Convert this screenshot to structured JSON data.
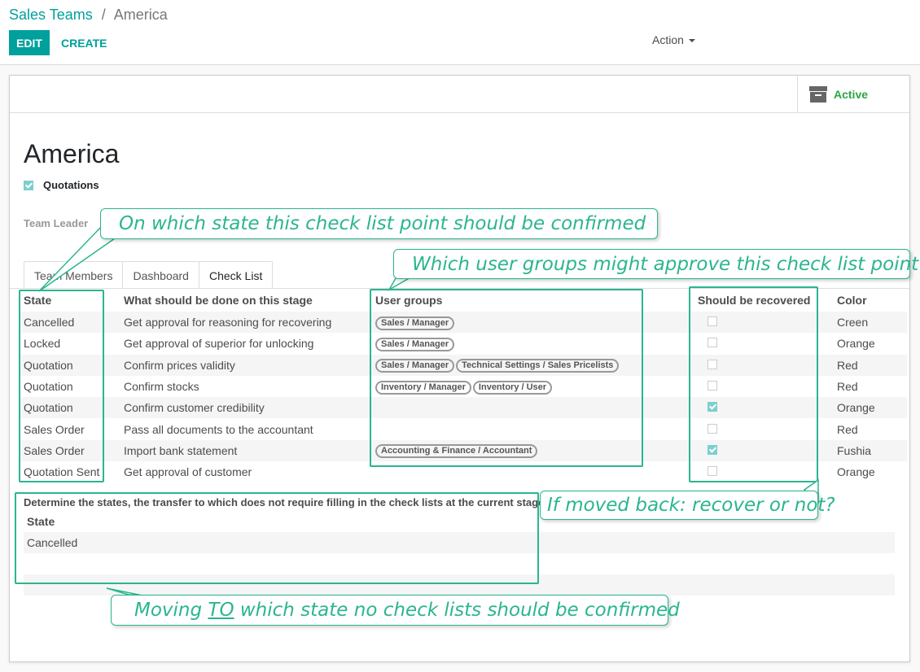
{
  "breadcrumb": {
    "parent": "Sales Teams",
    "separator": "/",
    "current": "America"
  },
  "toolbar": {
    "edit_label": "EDIT",
    "create_label": "CREATE",
    "action_label": "Action"
  },
  "button_box": {
    "active_label": "Active",
    "archive_icon": "archive-icon"
  },
  "record": {
    "title": "America",
    "quotations_label": "Quotations",
    "quotations_checked": true,
    "team_leader_label": "Team Leader"
  },
  "tabs": [
    {
      "label": "Team Members",
      "active": false
    },
    {
      "label": "Dashboard",
      "active": false
    },
    {
      "label": "Check List",
      "active": true
    }
  ],
  "check_list": {
    "columns": [
      "State",
      "What should be done on this stage",
      "User groups",
      "Should be recovered",
      "Color"
    ],
    "rows": [
      {
        "state": "Cancelled",
        "action": "Get approval for reasoning for recovering",
        "groups": [
          "Sales / Manager"
        ],
        "recovered": false,
        "color": "Creen"
      },
      {
        "state": "Locked",
        "action": "Get approval of superior for unlocking",
        "groups": [
          "Sales / Manager"
        ],
        "recovered": false,
        "color": "Orange"
      },
      {
        "state": "Quotation",
        "action": "Confirm prices validity",
        "groups": [
          "Sales / Manager",
          "Technical Settings / Sales Pricelists"
        ],
        "recovered": false,
        "color": "Red"
      },
      {
        "state": "Quotation",
        "action": "Confirm stocks",
        "groups": [
          "Inventory / Manager",
          "Inventory / User"
        ],
        "recovered": false,
        "color": "Red"
      },
      {
        "state": "Quotation",
        "action": "Confirm customer credibility",
        "groups": [],
        "recovered": true,
        "color": "Orange"
      },
      {
        "state": "Sales Order",
        "action": "Pass all documents to the accountant",
        "groups": [],
        "recovered": false,
        "color": "Red"
      },
      {
        "state": "Sales Order",
        "action": "Import bank statement",
        "groups": [
          "Accounting & Finance / Accountant"
        ],
        "recovered": true,
        "color": "Fushia"
      },
      {
        "state": "Quotation Sent",
        "action": "Get approval of customer",
        "groups": [],
        "recovered": false,
        "color": "Orange"
      }
    ]
  },
  "no_check_states": {
    "title": "Determine the states, the transfer to which does not require filling in the check lists at the current stage",
    "column": "State",
    "rows": [
      "Cancelled"
    ]
  },
  "callouts": {
    "state": "On which state this check list point should be confirmed",
    "groups": "Which user groups might approve this check list point",
    "recover": "If moved back: recover or not?",
    "moving_pre": "Moving ",
    "moving_to": "TO",
    "moving_post": " which state no check lists should be confirmed"
  },
  "colors": {
    "accent": "#00a09d",
    "annotation": "#2bb590",
    "active": "#28a745"
  }
}
